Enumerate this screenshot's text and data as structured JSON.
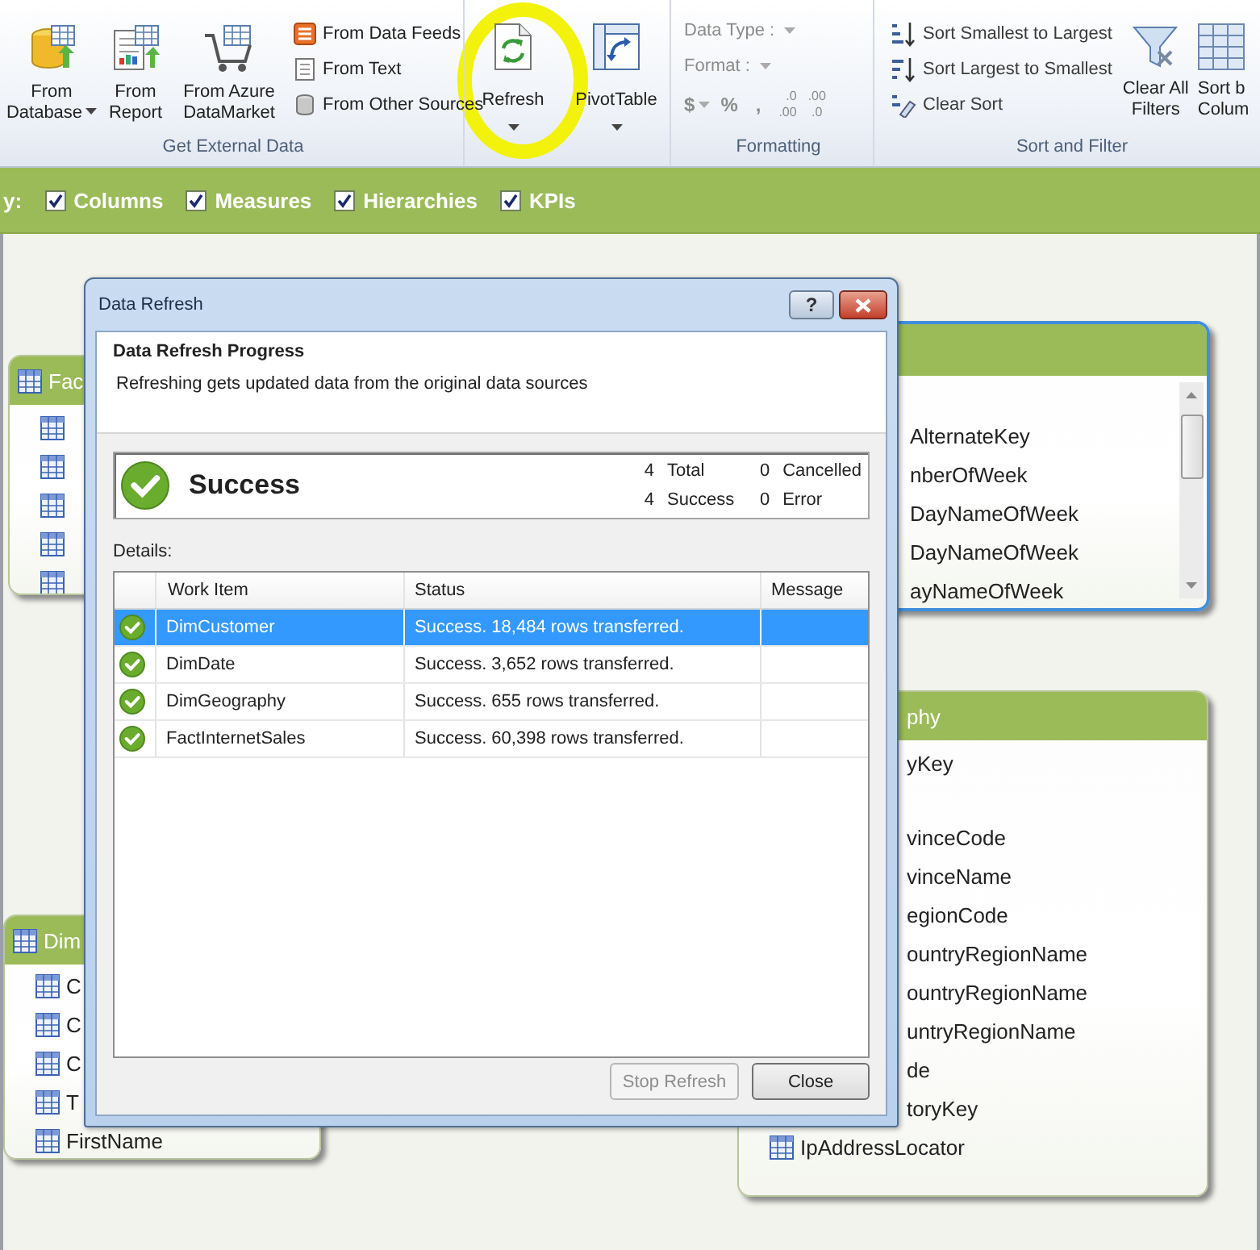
{
  "ribbon": {
    "get_external_data": {
      "label": "Get External Data",
      "large_buttons": [
        {
          "kind": "database",
          "label": "From Database",
          "dropdown": true
        },
        {
          "kind": "report",
          "label": "From Report",
          "dropdown": false
        },
        {
          "kind": "cart",
          "label": "From Azure DataMarket",
          "dropdown": false
        }
      ],
      "small_buttons": [
        {
          "kind": "feeds",
          "label": "From Data Feeds"
        },
        {
          "kind": "text",
          "label": "From Text"
        },
        {
          "kind": "other",
          "label": "From Other Sources"
        }
      ]
    },
    "refresh": {
      "label": "Refresh",
      "dropdown": true
    },
    "pivottable": {
      "label": "PivotTable",
      "dropdown": true
    },
    "formatting": {
      "label": "Formatting",
      "disabled": true,
      "data_type": "Data Type :",
      "format": "Format :",
      "currency": "$",
      "percent": "%",
      "comma": ",",
      "decimal_buttons": [
        {
          "top": ".0",
          "bottom": ".00"
        },
        {
          "top": ".00",
          "bottom": ".0"
        }
      ]
    },
    "sort_and_filter": {
      "label": "Sort and Filter",
      "items": [
        {
          "kind": "asc",
          "label": "Sort Smallest to Largest"
        },
        {
          "kind": "desc",
          "label": "Sort Largest to Smallest"
        },
        {
          "kind": "clear",
          "label": "Clear Sort"
        }
      ],
      "clear_filters": "Clear All Filters",
      "sort_by_column": [
        "Sort b",
        "Colum"
      ]
    }
  },
  "show_bar": {
    "label": "y:",
    "checkboxes": [
      {
        "label": "Columns",
        "checked": true
      },
      {
        "label": "Measures",
        "checked": true
      },
      {
        "label": "Hierarchies",
        "checked": true
      },
      {
        "label": "KPIs",
        "checked": true
      }
    ]
  },
  "tables": [
    {
      "title": "Fac",
      "selected": false,
      "items": [
        {
          "kind": "icon"
        },
        {
          "kind": "icon"
        },
        {
          "kind": "icon"
        },
        {
          "kind": "icon"
        },
        {
          "kind": "icon"
        }
      ]
    },
    {
      "selected": true,
      "items": [
        {
          "kind": "cut",
          "text": "AlternateKey"
        },
        {
          "kind": "cut",
          "text": "nberOfWeek"
        },
        {
          "kind": "cut",
          "text": "DayNameOfWeek"
        },
        {
          "kind": "cut",
          "text": "DayNameOfWeek"
        },
        {
          "kind": "cut",
          "text": "ayNameOfWeek"
        }
      ]
    },
    {
      "title": "phy",
      "selected": false,
      "items": [
        {
          "kind": "cut",
          "text": "yKey"
        },
        {
          "kind": "cut",
          "text": "vinceCode"
        },
        {
          "kind": "cut",
          "text": "vinceName"
        },
        {
          "kind": "cut",
          "text": "egionCode"
        },
        {
          "kind": "cut",
          "text": "ountryRegionName"
        },
        {
          "kind": "cut",
          "text": "ountryRegionName"
        },
        {
          "kind": "cut",
          "text": "untryRegionName"
        },
        {
          "kind": "cut",
          "text": "de"
        },
        {
          "kind": "cut",
          "text": "toryKey"
        },
        {
          "kind": "full",
          "text": "IpAddressLocator"
        }
      ]
    },
    {
      "title": "Dim",
      "selected": false,
      "items": [
        {
          "kind": "full",
          "text": "C"
        },
        {
          "kind": "full",
          "text": "C"
        },
        {
          "kind": "full",
          "text": "C"
        },
        {
          "kind": "full",
          "text": "T"
        },
        {
          "kind": "full",
          "text": "FirstName"
        }
      ]
    }
  ],
  "dialog": {
    "title": "Data Refresh",
    "help": "?",
    "heading": "Data Refresh Progress",
    "description": "Refreshing gets updated data from the original data sources",
    "result": "Success",
    "stats": [
      {
        "count": "4",
        "label": "Total"
      },
      {
        "count": "0",
        "label": "Cancelled"
      },
      {
        "count": "4",
        "label": "Success"
      },
      {
        "count": "0",
        "label": "Error"
      }
    ],
    "details_label": "Details:",
    "columns": [
      "Work Item",
      "Status",
      "Message"
    ],
    "rows": [
      {
        "work_item": "DimCustomer",
        "status": "Success. 18,484 rows transferred.",
        "selected": true
      },
      {
        "work_item": "DimDate",
        "status": "Success. 3,652 rows transferred.",
        "selected": false
      },
      {
        "work_item": "DimGeography",
        "status": "Success. 655 rows transferred.",
        "selected": false
      },
      {
        "work_item": "FactInternetSales",
        "status": "Success. 60,398 rows transferred.",
        "selected": false
      }
    ],
    "buttons": [
      {
        "label": "Stop Refresh",
        "disabled": true
      },
      {
        "label": "Close",
        "disabled": false
      }
    ]
  }
}
